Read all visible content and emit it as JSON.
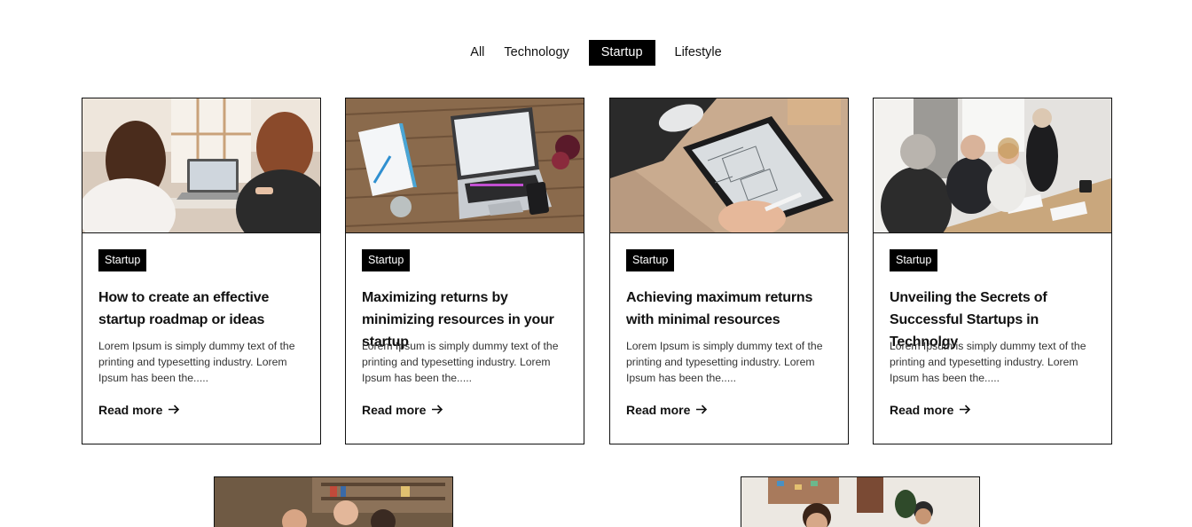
{
  "filters": {
    "items": [
      "All",
      "Technology",
      "Startup",
      "Lifestyle"
    ],
    "active": "Startup"
  },
  "cards": [
    {
      "category": "Startup",
      "title": "How to create an effective startup roadmap or ideas",
      "excerpt": "Lorem Ipsum is simply dummy text of the printing and typesetting industry. Lorem Ipsum has been the.....",
      "read_more": "Read more"
    },
    {
      "category": "Startup",
      "title": "Maximizing returns by minimizing resources in your startup",
      "excerpt": "Lorem Ipsum is simply dummy text of the printing and typesetting industry. Lorem Ipsum has been the.....",
      "read_more": "Read more"
    },
    {
      "category": "Startup",
      "title": "Achieving maximum returns with minimal resources",
      "excerpt": "Lorem Ipsum is simply dummy text of the printing and typesetting industry. Lorem Ipsum has been the.....",
      "read_more": "Read more"
    },
    {
      "category": "Startup",
      "title": "Unveiling the Secrets of Successful Startups in Technolgy",
      "excerpt": "Lorem Ipsum is simply dummy text of the printing and typesetting industry. Lorem Ipsum has been the.....",
      "read_more": "Read more"
    }
  ],
  "icons": {
    "read_more_arrow": "arrow-right-icon"
  },
  "colors": {
    "accent": "#000000",
    "text": "#111111",
    "muted": "#333333"
  }
}
